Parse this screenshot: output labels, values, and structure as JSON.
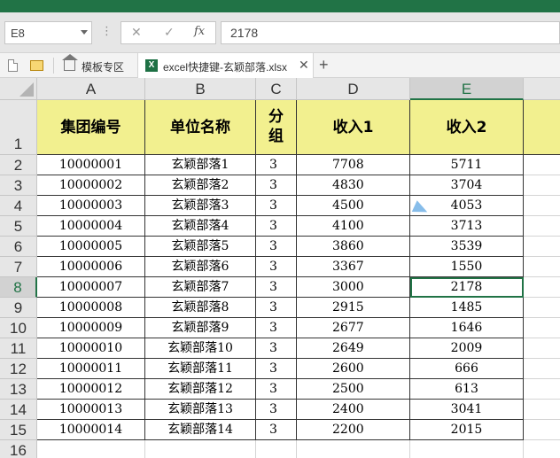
{
  "formula_bar": {
    "name_box": "E8",
    "cancel_glyph": "✕",
    "enter_glyph": "✓",
    "fx_label": "fx",
    "value": "2178"
  },
  "tabs": {
    "home_label": "模板专区",
    "file_label": "excel快捷键-玄颖部落.xlsx",
    "file_icon_glyph": "X",
    "close_glyph": "✕",
    "new_tab_glyph": "+"
  },
  "icons": {
    "new_doc": "doc-icon",
    "open_folder": "folder-icon",
    "home": "home-icon",
    "excel_file": "xls-icon",
    "close_tab": "close-icon",
    "new_tab": "plus-icon",
    "mouse_cursor": "cursor-icon"
  },
  "colors": {
    "accent": "#217346",
    "header_fill": "#f2f08f"
  },
  "sheet": {
    "columns": [
      "A",
      "B",
      "C",
      "D",
      "E"
    ],
    "selected_cell": "E8",
    "header_row_number": "1",
    "headers": [
      "集团编号",
      "单位名称",
      "分组",
      "收入1",
      "收入2"
    ],
    "rows": [
      {
        "num": "2",
        "cells": [
          "10000001",
          "玄颖部落1",
          "3",
          "7708",
          "5711"
        ]
      },
      {
        "num": "3",
        "cells": [
          "10000002",
          "玄颖部落2",
          "3",
          "4830",
          "3704"
        ]
      },
      {
        "num": "4",
        "cells": [
          "10000003",
          "玄颖部落3",
          "3",
          "4500",
          "4053"
        ]
      },
      {
        "num": "5",
        "cells": [
          "10000004",
          "玄颖部落4",
          "3",
          "4100",
          "3713"
        ]
      },
      {
        "num": "6",
        "cells": [
          "10000005",
          "玄颖部落5",
          "3",
          "3860",
          "3539"
        ]
      },
      {
        "num": "7",
        "cells": [
          "10000006",
          "玄颖部落6",
          "3",
          "3367",
          "1550"
        ]
      },
      {
        "num": "8",
        "cells": [
          "10000007",
          "玄颖部落7",
          "3",
          "3000",
          "2178"
        ]
      },
      {
        "num": "9",
        "cells": [
          "10000008",
          "玄颖部落8",
          "3",
          "2915",
          "1485"
        ]
      },
      {
        "num": "10",
        "cells": [
          "10000009",
          "玄颖部落9",
          "3",
          "2677",
          "1646"
        ]
      },
      {
        "num": "11",
        "cells": [
          "10000010",
          "玄颖部落10",
          "3",
          "2649",
          "2009"
        ]
      },
      {
        "num": "12",
        "cells": [
          "10000011",
          "玄颖部落11",
          "3",
          "2600",
          "666"
        ]
      },
      {
        "num": "13",
        "cells": [
          "10000012",
          "玄颖部落12",
          "3",
          "2500",
          "613"
        ]
      },
      {
        "num": "14",
        "cells": [
          "10000013",
          "玄颖部落13",
          "3",
          "2400",
          "3041"
        ]
      },
      {
        "num": "15",
        "cells": [
          "10000014",
          "玄颖部落14",
          "3",
          "2200",
          "2015"
        ]
      }
    ],
    "trailing_row_number": "16"
  }
}
